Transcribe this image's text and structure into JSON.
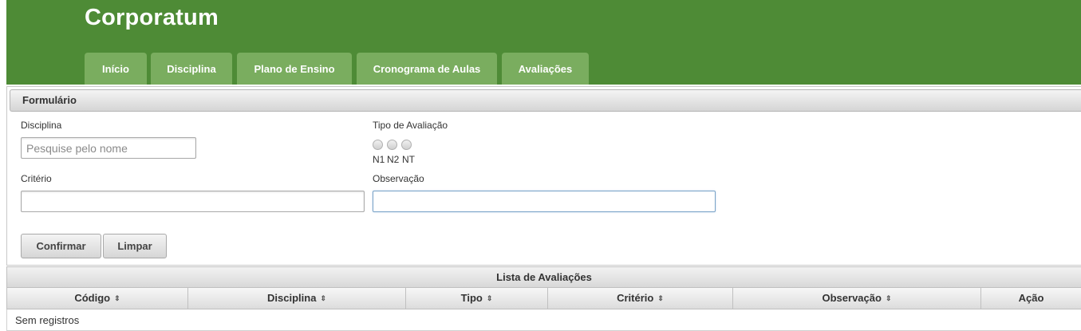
{
  "app": {
    "title": "Corporatum"
  },
  "tabs": [
    {
      "label": "Início"
    },
    {
      "label": "Disciplina"
    },
    {
      "label": "Plano de Ensino"
    },
    {
      "label": "Cronograma de Aulas"
    },
    {
      "label": "Avaliações"
    }
  ],
  "colors": {
    "header_bg": "#4e8b36",
    "tab_bg": "#7aad5f"
  },
  "form": {
    "title": "Formulário",
    "disciplina": {
      "label": "Disciplina",
      "placeholder": "Pesquise pelo nome",
      "value": ""
    },
    "tipo": {
      "label": "Tipo de Avaliação",
      "options": [
        {
          "label": "N1"
        },
        {
          "label": "N2"
        },
        {
          "label": "NT"
        }
      ],
      "selected": null
    },
    "criterio": {
      "label": "Critério",
      "value": ""
    },
    "observacao": {
      "label": "Observação",
      "value": ""
    },
    "confirm_label": "Confirmar",
    "clear_label": "Limpar"
  },
  "table": {
    "caption": "Lista de Avaliações",
    "columns": [
      {
        "label": "Código",
        "sortable": true
      },
      {
        "label": "Disciplina",
        "sortable": true
      },
      {
        "label": "Tipo",
        "sortable": true
      },
      {
        "label": "Critério",
        "sortable": true
      },
      {
        "label": "Observação",
        "sortable": true
      },
      {
        "label": "Ação",
        "sortable": false
      }
    ],
    "sort_icon": "sort-updown-icon",
    "rows": [],
    "empty_message": "Sem registros"
  }
}
